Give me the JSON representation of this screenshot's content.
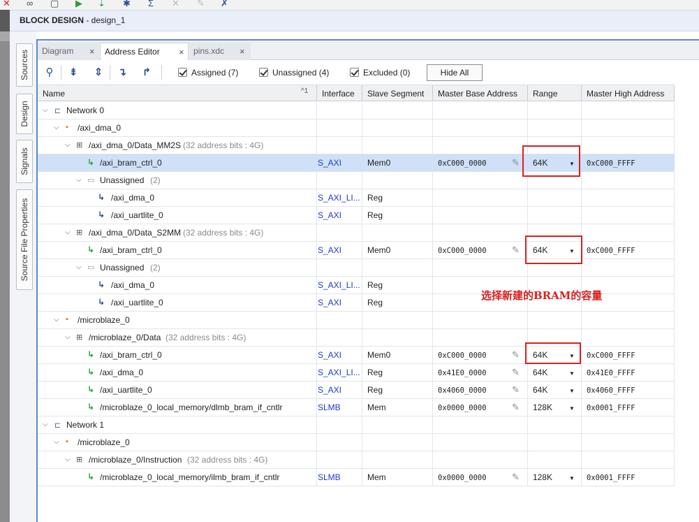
{
  "title": {
    "bold": "BLOCK DESIGN",
    "rest": " - design_1"
  },
  "side_tabs": [
    "Sources",
    "Design",
    "Signals",
    "Source File Properties"
  ],
  "tabs": [
    {
      "label": "Diagram",
      "active": false
    },
    {
      "label": "Address Editor",
      "active": true
    },
    {
      "label": "pins.xdc",
      "active": false
    }
  ],
  "toolbar": {
    "icons": [
      "search-icon",
      "collapse-all-icon",
      "expand-all-icon",
      "assign-icon",
      "unassign-icon"
    ],
    "filters": [
      {
        "label": "Assigned (7)",
        "checked": true
      },
      {
        "label": "Unassigned (4)",
        "checked": true
      },
      {
        "label": "Excluded (0)",
        "checked": true
      }
    ],
    "hide_all": "Hide All"
  },
  "columns": [
    "Name",
    "Interface",
    "Slave Segment",
    "Master Base Address",
    "Range",
    "Master High Address"
  ],
  "sort_indicator": "^1",
  "rows": [
    {
      "name": "Network 0",
      "extra": ""
    },
    {
      "name": "/axi_dma_0",
      "extra": ""
    },
    {
      "name": "/axi_dma_0/Data_MM2S",
      "extra": "(32 address bits : 4G)"
    },
    {
      "name": "/axi_bram_ctrl_0",
      "interface": "S_AXI",
      "segment": "Mem0",
      "base": "0xC000_0000",
      "range": "64K",
      "high": "0xC000_FFFF"
    },
    {
      "name": "Unassigned",
      "extra": "(2)"
    },
    {
      "name": "/axi_dma_0",
      "interface": "S_AXI_LI...",
      "segment": "Reg"
    },
    {
      "name": "/axi_uartlite_0",
      "interface": "S_AXI",
      "segment": "Reg"
    },
    {
      "name": "/axi_dma_0/Data_S2MM",
      "extra": "(32 address bits : 4G)"
    },
    {
      "name": "/axi_bram_ctrl_0",
      "interface": "S_AXI",
      "segment": "Mem0",
      "base": "0xC000_0000",
      "range": "64K",
      "high": "0xC000_FFFF"
    },
    {
      "name": "Unassigned",
      "extra": "(2)"
    },
    {
      "name": "/axi_dma_0",
      "interface": "S_AXI_LI...",
      "segment": "Reg"
    },
    {
      "name": "/axi_uartlite_0",
      "interface": "S_AXI",
      "segment": "Reg"
    },
    {
      "name": "/microblaze_0",
      "extra": ""
    },
    {
      "name": "/microblaze_0/Data",
      "extra": "(32 address bits : 4G)"
    },
    {
      "name": "/axi_bram_ctrl_0",
      "interface": "S_AXI",
      "segment": "Mem0",
      "base": "0xC000_0000",
      "range": "64K",
      "high": "0xC000_FFFF"
    },
    {
      "name": "/axi_dma_0",
      "interface": "S_AXI_LI...",
      "segment": "Reg",
      "base": "0x41E0_0000",
      "range": "64K",
      "high": "0x41E0_FFFF"
    },
    {
      "name": "/axi_uartlite_0",
      "interface": "S_AXI",
      "segment": "Reg",
      "base": "0x4060_0000",
      "range": "64K",
      "high": "0x4060_FFFF"
    },
    {
      "name": "/microblaze_0_local_memory/dlmb_bram_if_cntlr",
      "interface": "SLMB",
      "segment": "Mem",
      "base": "0x0000_0000",
      "range": "128K",
      "high": "0x0001_FFFF"
    },
    {
      "name": "Network 1",
      "extra": ""
    },
    {
      "name": "/microblaze_0",
      "extra": ""
    },
    {
      "name": "/microblaze_0/Instruction",
      "extra": "(32 address bits : 4G)"
    },
    {
      "name": "/microblaze_0_local_memory/ilmb_bram_if_cntlr",
      "interface": "SLMB",
      "segment": "Mem",
      "base": "0x0000_0000",
      "range": "128K",
      "high": "0x0001_FFFF"
    }
  ],
  "annotation": "选择新建的BRAM的容量",
  "colors": {
    "accent": "#5d89c6",
    "selected_row": "#cfe0f7",
    "annotation_red": "#d9201f",
    "link_blue": "#1a3cc7"
  }
}
